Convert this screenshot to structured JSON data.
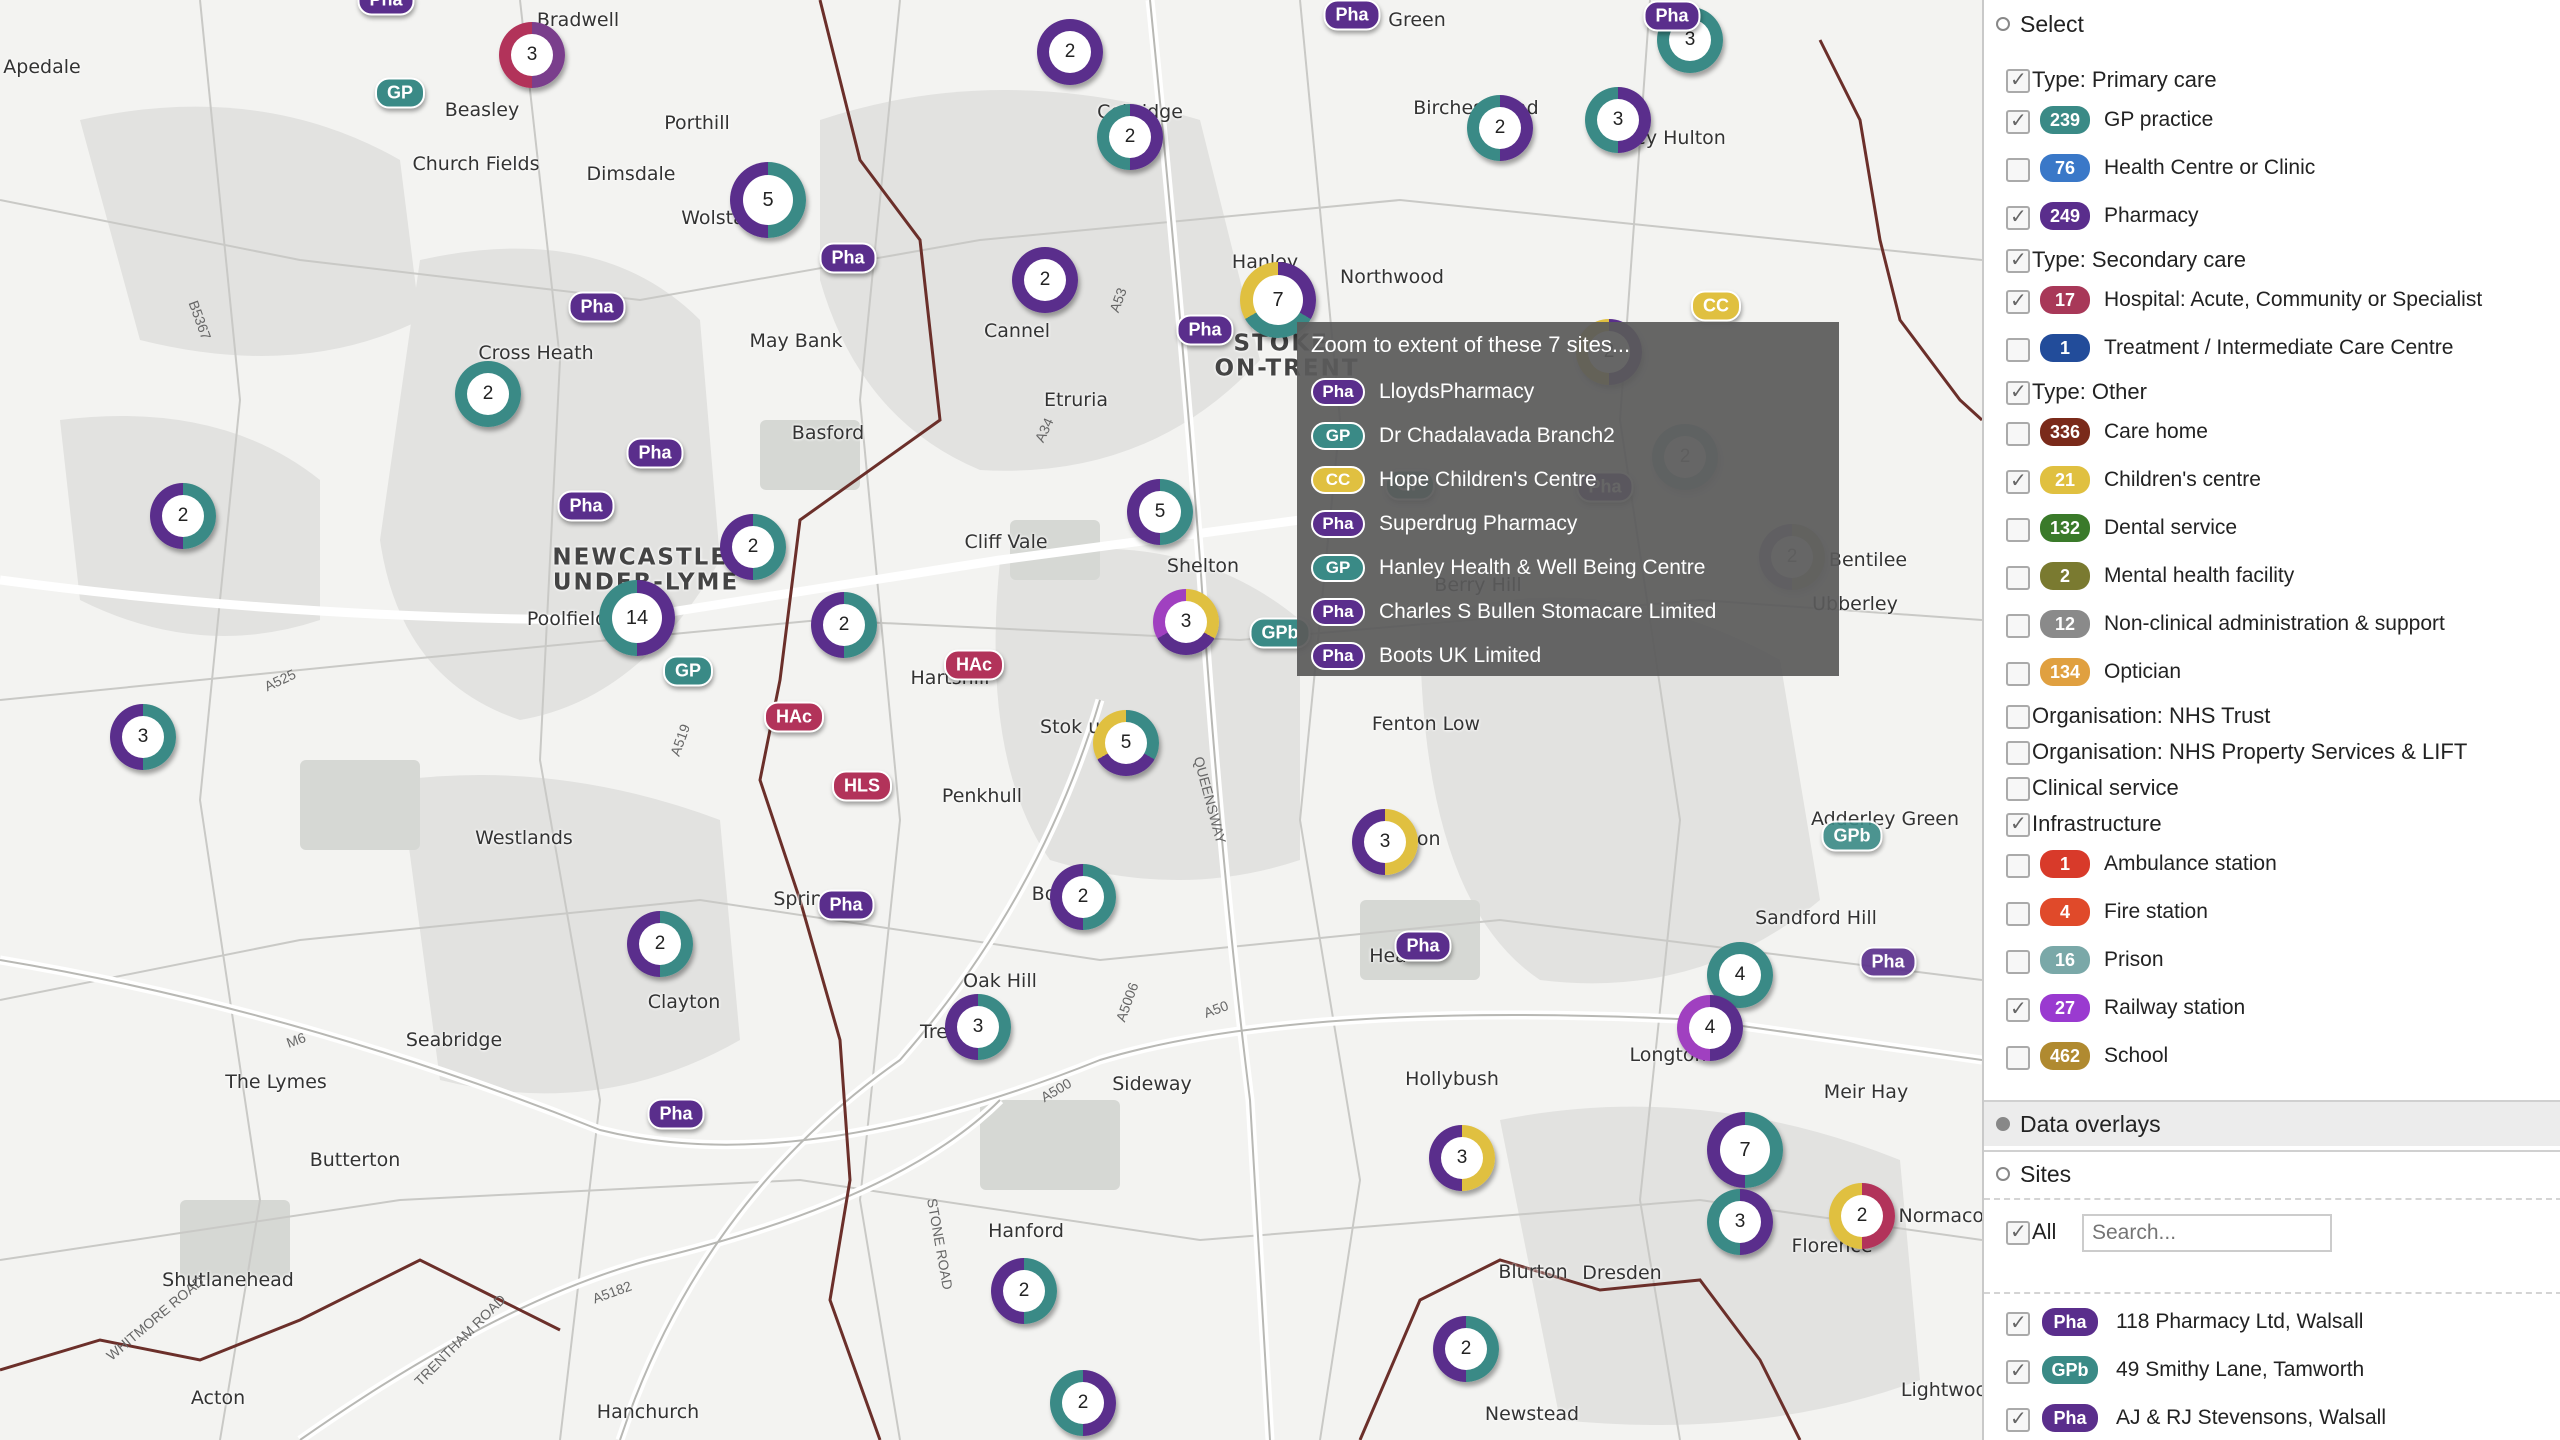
{
  "map": {
    "places": [
      {
        "text": "Apedale"
      },
      {
        "text": "Bradwell"
      },
      {
        "text": "Beasley"
      },
      {
        "text": "Porthill"
      },
      {
        "text": "Church Fields"
      },
      {
        "text": "Dimsdale"
      },
      {
        "text": "Wolsta"
      },
      {
        "text": "Cobridge"
      },
      {
        "text": "Birches Head"
      },
      {
        "text": "Hanley"
      },
      {
        "text": "Northwood"
      },
      {
        "text": "Bentilee"
      },
      {
        "text": "Ubberley"
      },
      {
        "text": "May Bank"
      },
      {
        "text": "Cross Heath"
      },
      {
        "text": "Etruria"
      },
      {
        "text": "Basford"
      },
      {
        "text": "Cliff Vale"
      },
      {
        "text": "Shelton"
      },
      {
        "text": "Poolfields"
      },
      {
        "text": "Hartshill"
      },
      {
        "text": "Penkhull"
      },
      {
        "text": "Fenton Low"
      },
      {
        "text": "Westlands"
      },
      {
        "text": "Clayton"
      },
      {
        "text": "Oak Hill"
      },
      {
        "text": "Seabridge"
      },
      {
        "text": "The Lymes"
      },
      {
        "text": "Sideway"
      },
      {
        "text": "Hollybush"
      },
      {
        "text": "Longton"
      },
      {
        "text": "Meir Hay"
      },
      {
        "text": "Butterton"
      },
      {
        "text": "Hanford"
      },
      {
        "text": "Blurton"
      },
      {
        "text": "Dresden"
      },
      {
        "text": "Florence"
      },
      {
        "text": "Shutlanehead"
      },
      {
        "text": "Acton"
      },
      {
        "text": "Hanchurch"
      },
      {
        "text": "Newstead"
      },
      {
        "text": "Sandford Hill"
      },
      {
        "text": "Adderley Green"
      },
      {
        "text": "Lightwood"
      },
      {
        "text": "Green"
      },
      {
        "text": "ey Hulton"
      },
      {
        "text": "Sprin"
      },
      {
        "text": "Bo"
      },
      {
        "text": "Tre"
      },
      {
        "text": "Hea"
      },
      {
        "text": "ton"
      },
      {
        "text": "Berry Hill"
      },
      {
        "text": "Normacot"
      },
      {
        "text": "Stok upon"
      },
      {
        "text": "Cannel"
      }
    ],
    "big_places": [
      {
        "text": "NEWCASTLE-\nUNDER-LYME"
      },
      {
        "text": "STOKE-\nON-TRENT"
      }
    ],
    "roads": [
      {
        "text": "A500"
      },
      {
        "text": "A50"
      },
      {
        "text": "A5006"
      },
      {
        "text": "A525"
      },
      {
        "text": "A519"
      },
      {
        "text": "A34"
      },
      {
        "text": "A5182"
      },
      {
        "text": "M6"
      },
      {
        "text": "QUEENSWAY"
      },
      {
        "text": "STONE ROAD"
      },
      {
        "text": "TRENTHAM ROAD"
      },
      {
        "text": "WHITMORE ROAD"
      },
      {
        "text": "B5367"
      },
      {
        "text": "A53"
      }
    ],
    "clusters": [
      {
        "n": "3",
        "colors": [
          "#7a3e8c",
          "#b2335a"
        ]
      },
      {
        "n": "2",
        "colors": [
          "#5a2e8c"
        ]
      },
      {
        "n": "3",
        "colors": [
          "#5a2e8c",
          "#3a8a86"
        ]
      },
      {
        "n": "2",
        "colors": [
          "#5a2e8c",
          "#3a8a86"
        ]
      },
      {
        "n": "2",
        "colors": [
          "#5a2e8c",
          "#3a8a86"
        ]
      },
      {
        "n": "3",
        "colors": [
          "#3a8a86"
        ]
      },
      {
        "n": "5",
        "colors": [
          "#3a8a86",
          "#5a2e8c"
        ]
      },
      {
        "n": "2",
        "colors": [
          "#5a2e8c"
        ]
      },
      {
        "n": "7",
        "colors": [
          "#5a2e8c",
          "#3a8a86",
          "#e0c040"
        ]
      },
      {
        "n": "2",
        "colors": [
          "#5a2e8c",
          "#e0c040"
        ]
      },
      {
        "n": "2",
        "colors": [
          "#3a8a86"
        ]
      },
      {
        "n": "2",
        "colors": [
          "#3a8a86",
          "#5a2e8c"
        ]
      },
      {
        "n": "2",
        "colors": [
          "#3a8a86",
          "#5a2e8c"
        ]
      },
      {
        "n": "5",
        "colors": [
          "#3a8a86",
          "#5a2e8c"
        ]
      },
      {
        "n": "14",
        "colors": [
          "#5a2e8c",
          "#3a8a86"
        ]
      },
      {
        "n": "2",
        "colors": [
          "#3a8a86",
          "#5a2e8c"
        ]
      },
      {
        "n": "3",
        "colors": [
          "#e0c040",
          "#5a2e8c",
          "#a040c0"
        ]
      },
      {
        "n": "5",
        "colors": [
          "#3a8a86",
          "#5a2e8c",
          "#e0c040"
        ]
      },
      {
        "n": "3",
        "colors": [
          "#3a8a86",
          "#5a2e8c"
        ]
      },
      {
        "n": "3",
        "colors": [
          "#e0c040",
          "#5a2e8c"
        ]
      },
      {
        "n": "2",
        "colors": [
          "#3a8a86",
          "#5a2e8c"
        ]
      },
      {
        "n": "2",
        "colors": [
          "#3a8a86",
          "#5a2e8c"
        ]
      },
      {
        "n": "3",
        "colors": [
          "#3a8a86",
          "#5a2e8c"
        ]
      },
      {
        "n": "4",
        "colors": [
          "#3a8a86"
        ]
      },
      {
        "n": "4",
        "colors": [
          "#5a2e8c",
          "#a040c0"
        ]
      },
      {
        "n": "3",
        "colors": [
          "#e0c040",
          "#5a2e8c"
        ]
      },
      {
        "n": "7",
        "colors": [
          "#3a8a86",
          "#5a2e8c"
        ]
      },
      {
        "n": "3",
        "colors": [
          "#5a2e8c",
          "#3a8a86"
        ]
      },
      {
        "n": "2",
        "colors": [
          "#b2335a",
          "#e0c040"
        ]
      },
      {
        "n": "2",
        "colors": [
          "#3a8a86",
          "#5a2e8c"
        ]
      },
      {
        "n": "2",
        "colors": [
          "#3a8a86",
          "#5a2e8c"
        ]
      },
      {
        "n": "2",
        "colors": [
          "#5a2e8c",
          "#3a8a86"
        ]
      },
      {
        "n": "2",
        "colors": [
          "#8a8a30",
          "#5a2e8c"
        ]
      },
      {
        "n": "2",
        "colors": [
          "#3a8a86"
        ]
      }
    ],
    "pins": [
      {
        "text": "GP",
        "color": "#3a8a86"
      },
      {
        "text": "Pha",
        "color": "#5a2e8c"
      },
      {
        "text": "Pha",
        "color": "#5a2e8c"
      },
      {
        "text": "Pha",
        "color": "#5a2e8c"
      },
      {
        "text": "Pha",
        "color": "#5a2e8c"
      },
      {
        "text": "Pha",
        "color": "#5a2e8c"
      },
      {
        "text": "Pha",
        "color": "#5a2e8c"
      },
      {
        "text": "GP",
        "color": "#3a8a86"
      },
      {
        "text": "HAc",
        "color": "#b2335a"
      },
      {
        "text": "HAc",
        "color": "#b2335a"
      },
      {
        "text": "HLS",
        "color": "#b2335a"
      },
      {
        "text": "Pha",
        "color": "#5a2e8c"
      },
      {
        "text": "Pha",
        "color": "#5a2e8c"
      },
      {
        "text": "GPb",
        "color": "#3a8a86"
      },
      {
        "text": "CC",
        "color": "#e0c040"
      },
      {
        "text": "Pha",
        "color": "#5a2e8c"
      },
      {
        "text": "GPb",
        "color": "#3a8a86"
      },
      {
        "text": "Pha",
        "color": "#5a2e8c"
      },
      {
        "text": "Pha",
        "color": "#5a2e8c"
      },
      {
        "text": "Pha",
        "color": "#5a2e8c"
      },
      {
        "text": "Pha",
        "color": "#5a2e8c"
      },
      {
        "text": "GP",
        "color": "#3a8a86"
      }
    ]
  },
  "popup": {
    "title": "Zoom to extent of these 7 sites...",
    "items": [
      {
        "tag": "Pha",
        "color": "#5a2e8c",
        "label": "LloydsPharmacy"
      },
      {
        "tag": "GP",
        "color": "#3a8a86",
        "label": "Dr Chadalavada Branch2"
      },
      {
        "tag": "CC",
        "color": "#e0c040",
        "label": "Hope Children's Centre"
      },
      {
        "tag": "Pha",
        "color": "#5a2e8c",
        "label": "Superdrug Pharmacy"
      },
      {
        "tag": "GP",
        "color": "#3a8a86",
        "label": "Hanley Health & Well Being Centre"
      },
      {
        "tag": "Pha",
        "color": "#5a2e8c",
        "label": "Charles S Bullen Stomacare Limited"
      },
      {
        "tag": "Pha",
        "color": "#5a2e8c",
        "label": "Boots UK Limited"
      }
    ]
  },
  "sidebar": {
    "select_title": "Select",
    "groups": [
      {
        "label": "Type: Primary care",
        "checked": true
      },
      {
        "label": "Type: Secondary care",
        "checked": true
      },
      {
        "label": "Type: Other",
        "checked": true
      },
      {
        "label": "Organisation: NHS Trust",
        "checked": false
      },
      {
        "label": "Organisation: NHS Property Services & LIFT",
        "checked": false
      },
      {
        "label": "Clinical service",
        "checked": false
      },
      {
        "label": "Infrastructure",
        "checked": true
      }
    ],
    "rows": [
      {
        "count": "239",
        "label": "GP practice",
        "color": "#3a8a86",
        "checked": true
      },
      {
        "count": "76",
        "label": "Health Centre or Clinic",
        "color": "#3a78c8",
        "checked": false
      },
      {
        "count": "249",
        "label": "Pharmacy",
        "color": "#5a2e8c",
        "checked": true
      },
      {
        "count": "17",
        "label": "Hospital: Acute, Community or Specialist",
        "color": "#a83858",
        "checked": true
      },
      {
        "count": "1",
        "label": "Treatment / Intermediate Care Centre",
        "color": "#224c9a",
        "checked": false
      },
      {
        "count": "336",
        "label": "Care home",
        "color": "#7a2a1a",
        "checked": false
      },
      {
        "count": "21",
        "label": "Children's centre",
        "color": "#e0c040",
        "checked": true
      },
      {
        "count": "132",
        "label": "Dental service",
        "color": "#3a7a2a",
        "checked": false
      },
      {
        "count": "2",
        "label": "Mental health facility",
        "color": "#7a7a30",
        "checked": false
      },
      {
        "count": "12",
        "label": "Non-clinical administration & support",
        "color": "#8a8a8a",
        "checked": false
      },
      {
        "count": "134",
        "label": "Optician",
        "color": "#e0a040",
        "checked": false
      },
      {
        "count": "1",
        "label": "Ambulance station",
        "color": "#d83a2a",
        "checked": false
      },
      {
        "count": "4",
        "label": "Fire station",
        "color": "#e04a2a",
        "checked": false
      },
      {
        "count": "16",
        "label": "Prison",
        "color": "#7aa8a8",
        "checked": false
      },
      {
        "count": "27",
        "label": "Railway station",
        "color": "#9a3ad0",
        "checked": true
      },
      {
        "count": "462",
        "label": "School",
        "color": "#b08a30",
        "checked": false
      }
    ],
    "data_overlays": "Data overlays",
    "sites_title": "Sites",
    "all_label": "All",
    "search_placeholder": "Search...",
    "sites": [
      {
        "tag": "Pha",
        "color": "#5a2e8c",
        "label": "118 Pharmacy Ltd, Walsall"
      },
      {
        "tag": "GPb",
        "color": "#3a8a86",
        "label": "49 Smithy Lane, Tamworth"
      },
      {
        "tag": "Pha",
        "color": "#5a2e8c",
        "label": "AJ & RJ Stevensons, Walsall"
      }
    ]
  }
}
